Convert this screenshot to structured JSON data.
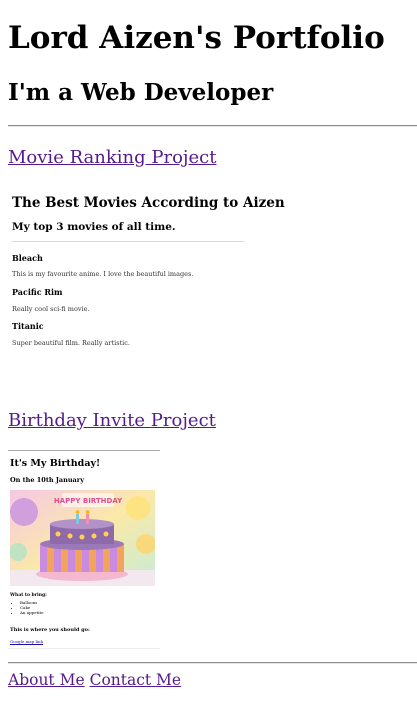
{
  "header": {
    "title": "Lord Aizen's Portfolio",
    "subtitle": "I'm a Web Developer"
  },
  "projects": [
    {
      "link": "Movie Ranking Project",
      "preview": {
        "title": "The Best Movies According to Aizen",
        "subtitle": "My top 3 movies of all time.",
        "movies": [
          {
            "name": "Bleach",
            "desc": "This is my favourite anime. I love the beautiful images."
          },
          {
            "name": "Pacific Rim",
            "desc": "Really cool sci-fi movie."
          },
          {
            "name": "Titanic",
            "desc": "Super beautiful film. Really artistic."
          }
        ]
      }
    },
    {
      "link": "Birthday Invite Project",
      "preview": {
        "title": "It's My Birthday!",
        "date": "On the 10th January",
        "cake_banner": "HAPPY BIRTHDAY",
        "bring_heading": "What to bring:",
        "bring_items": [
          "Balloons",
          "Cake",
          "An appetite"
        ],
        "where_heading": "This is where you should go:",
        "map_link": "Google map link"
      }
    }
  ],
  "footer": {
    "about": "About Me",
    "contact": "Contact Me"
  },
  "colors": {
    "link": "#551a8b",
    "rule": "#8c8c8c"
  }
}
